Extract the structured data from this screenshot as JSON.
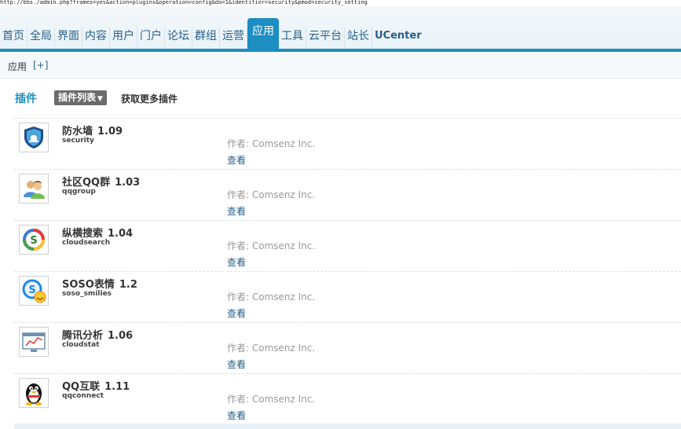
{
  "url_text": "http://bbs./admin.php?frames=yes&action=plugins&operation=config&do=1&identifier=security&pmod=security_setting",
  "nav": {
    "items": [
      {
        "label": "首页",
        "name": "nav-home"
      },
      {
        "label": "全局",
        "name": "nav-global"
      },
      {
        "label": "界面",
        "name": "nav-style"
      },
      {
        "label": "内容",
        "name": "nav-content"
      },
      {
        "label": "用户",
        "name": "nav-user"
      },
      {
        "label": "门户",
        "name": "nav-portal"
      },
      {
        "label": "论坛",
        "name": "nav-forum"
      },
      {
        "label": "群组",
        "name": "nav-group"
      },
      {
        "label": "运营",
        "name": "nav-operate"
      },
      {
        "label": "应用",
        "name": "nav-app",
        "active": true
      },
      {
        "label": "工具",
        "name": "nav-tools"
      },
      {
        "label": "云平台",
        "name": "nav-cloud"
      },
      {
        "label": "站长",
        "name": "nav-founder"
      },
      {
        "label": "UCenter",
        "name": "nav-ucenter"
      }
    ]
  },
  "subbar": {
    "label": "应用",
    "add": "[+]"
  },
  "section": {
    "title": "插件",
    "dropdown": "插件列表",
    "more": "获取更多插件"
  },
  "plugins": [
    {
      "name": "防水墙",
      "version": "1.09",
      "id": "security",
      "author": "作者: Comsenz Inc.",
      "view": "查看",
      "icon": "shield-icon"
    },
    {
      "name": "社区QQ群",
      "version": "1.03",
      "id": "qqgroup",
      "author": "作者: Comsenz Inc.",
      "view": "查看",
      "icon": "users-icon"
    },
    {
      "name": "纵横搜索",
      "version": "1.04",
      "id": "cloudsearch",
      "author": "作者: Comsenz Inc.",
      "view": "查看",
      "icon": "search-ring-icon"
    },
    {
      "name": "SOSO表情",
      "version": "1.2",
      "id": "soso_smilies",
      "author": "作者: Comsenz Inc.",
      "view": "查看",
      "icon": "soso-smiley-icon"
    },
    {
      "name": "腾讯分析",
      "version": "1.06",
      "id": "cloudstat",
      "author": "作者: Comsenz Inc.",
      "view": "查看",
      "icon": "chart-icon"
    },
    {
      "name": "QQ互联",
      "version": "1.11",
      "id": "qqconnect",
      "author": "作者: Comsenz Inc.",
      "view": "查看",
      "icon": "penguin-icon"
    }
  ],
  "colors": {
    "accent": "#1d8ec1",
    "link": "#27608c"
  }
}
